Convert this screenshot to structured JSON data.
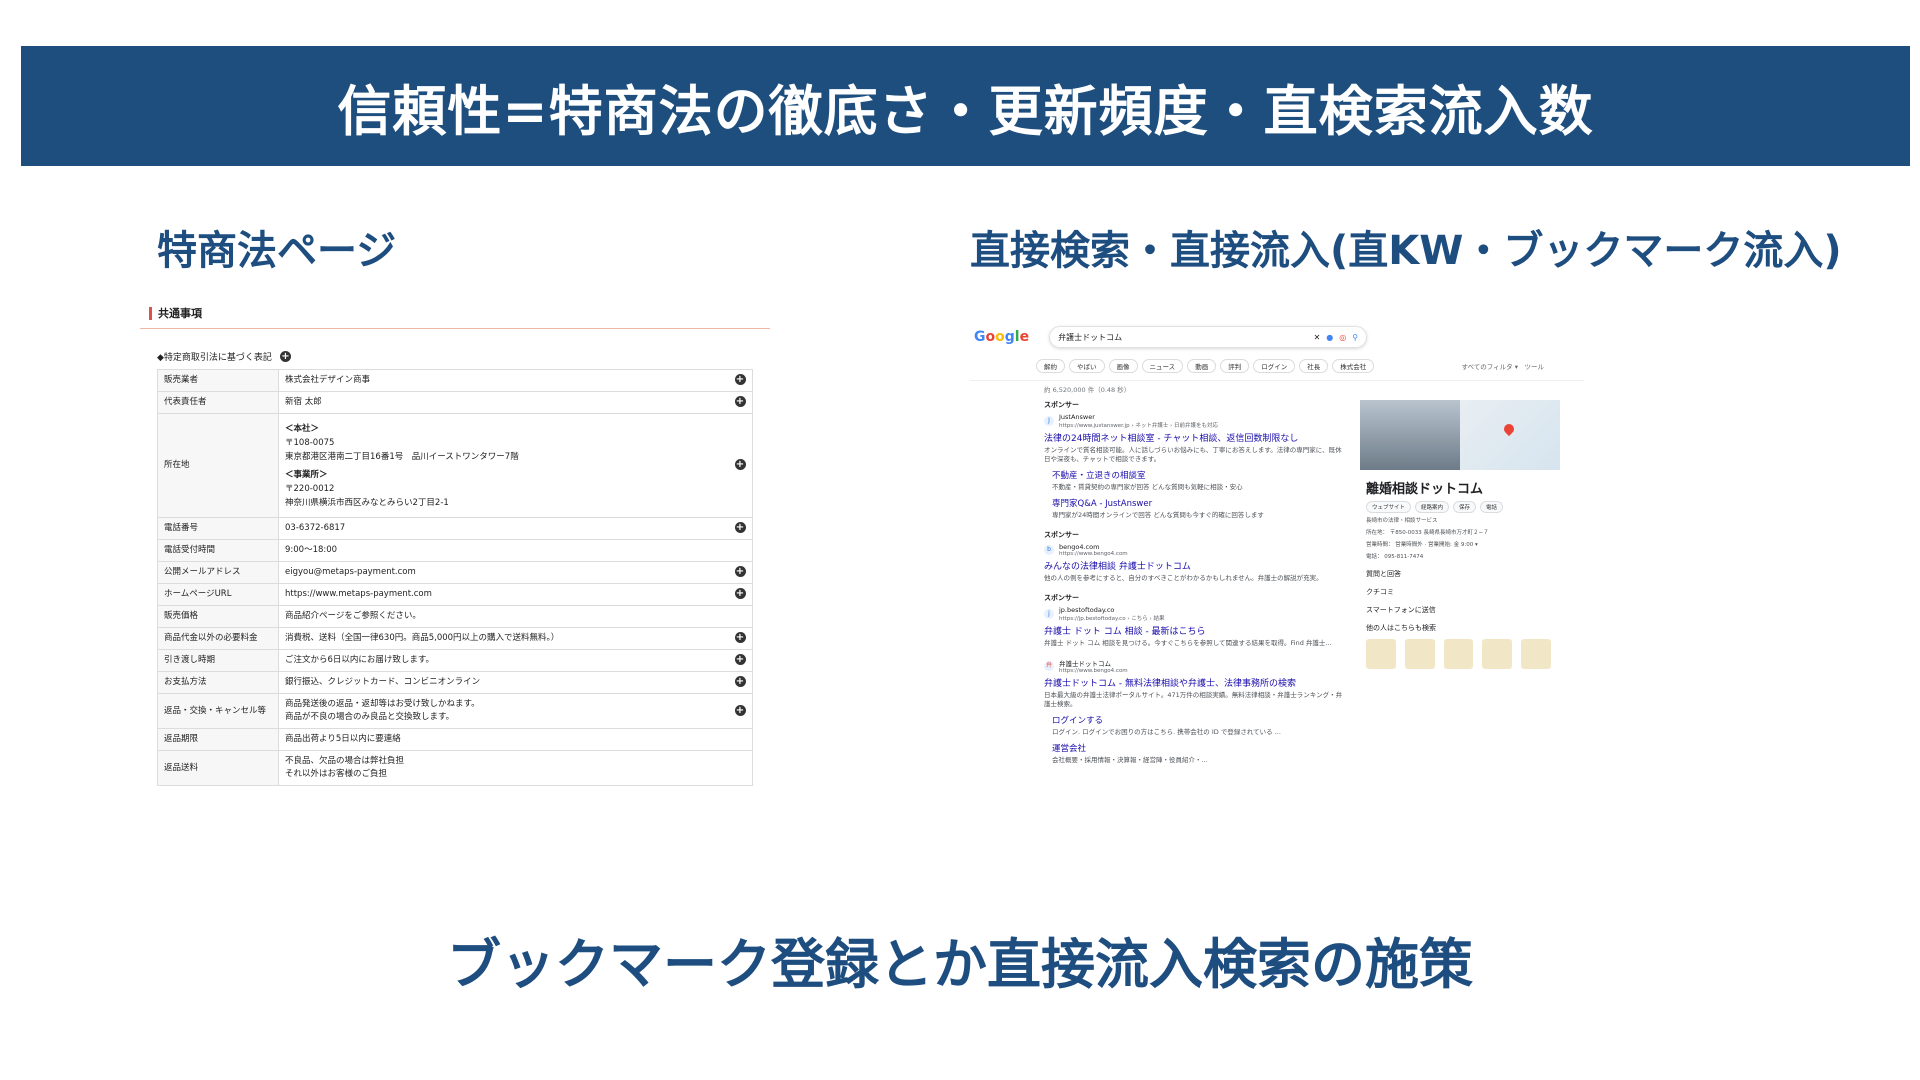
{
  "title": "信頼性=特商法の徹底さ・更新頻度・直検索流入数",
  "left_heading": "特商法ページ",
  "right_heading": "直接検索・直接流入(直KW・ブックマーク流入)",
  "footer": "ブックマーク登録とか直接流入検索の施策",
  "tokusho": {
    "section": "共通事項",
    "note": "◆特定商取引法に基づく表記",
    "rows": [
      {
        "k": "販売業者",
        "v": "株式会社デザイン商事"
      },
      {
        "k": "代表責任者",
        "v": "新宿 太郎"
      },
      {
        "k": "電話番号",
        "v": "03-6372-6817"
      },
      {
        "k": "電話受付時間",
        "v": "9:00～18:00"
      },
      {
        "k": "公開メールアドレス",
        "v": "eigyou@metaps-payment.com"
      },
      {
        "k": "ホームページURL",
        "v": "https://www.metaps-payment.com"
      },
      {
        "k": "販売価格",
        "v": "商品紹介ページをご参照ください。"
      },
      {
        "k": "商品代金以外の必要料金",
        "v": "消費税、送料（全国一律630円。商品5,000円以上の購入で送料無料。）"
      },
      {
        "k": "引き渡し時期",
        "v": "ご注文から6日以内にお届け致します。"
      },
      {
        "k": "お支払方法",
        "v": "銀行振込、クレジットカード、コンビニオンライン"
      },
      {
        "k": "返品・交換・キャンセル等",
        "v1": "商品発送後の返品・返却等はお受け致しかねます。",
        "v2": "商品が不良の場合のみ良品と交換致します。"
      },
      {
        "k": "返品期限",
        "v": "商品出荷より5日以内に要連絡"
      },
      {
        "k": "返品送料",
        "v1": "不良品、欠品の場合は弊社負担",
        "v2": "それ以外はお客様のご負担"
      }
    ],
    "address": {
      "k": "所在地",
      "h1": "＜本社＞",
      "zip1": "〒108-0075",
      "a1": "東京都港区港南二丁目16番1号　品川イーストワンタワー7階",
      "h2": "＜事業所＞",
      "zip2": "〒220-0012",
      "a2": "神奈川県横浜市西区みなとみらい2丁目2-1"
    }
  },
  "google": {
    "logo": "Google",
    "query": "弁護士ドットコム",
    "chips": [
      "解約",
      "やばい",
      "画像",
      "ニュース",
      "動画",
      "評判",
      "ログイン",
      "社長",
      "株式会社"
    ],
    "tools": "すべてのフィルタ ▾　ツール",
    "count": "約 6,520,000 件（0.48 秒）",
    "sponsor": "スポンサー",
    "r1_site": "JustAnswer",
    "r1_url": "https://www.justanswer.jp › ネット弁護士 › 日前弁護をも対応",
    "r1_title": "法律の24時間ネット相談室 - チャット相談、返信回数制限なし",
    "r1_snip": "オンラインで質名相談可能。人に話しづらいお悩みにも、丁寧にお答えします。法律の専門家に、既休日や深夜も、チャットで相談できます。",
    "r1_sub1": "不動産・立退きの相談室",
    "r1_sub1_snip": "不動産・賃貸契約の専門家が回答 どんな質問も気軽に相談・安心",
    "r1_sub2": "専門家Q&A - JustAnswer",
    "r1_sub2_snip": "専門家が24時間オンラインで回答 どんな質問も今すぐ的確に回答します",
    "r2_site": "bengo4.com",
    "r2_url": "https://www.bengo4.com",
    "r2_title": "みんなの法律相談 弁護士ドットコム",
    "r2_snip": "他の人の例を参考にすると、自分のすべきことがわかるかもしれません。弁護士の解説が充実。",
    "r3_site": "jp.bestoftoday.co",
    "r3_url": "https://jp.bestoftoday.co › こちら › 結果",
    "r3_title": "弁護士 ドット コム 相談 - 最新はこちら",
    "r3_snip": "弁護士 ドット コム 相談を見つける。今すぐこちらを参照して関連する結果を取得。Find 弁護士...",
    "r4_site": "弁護士ドットコム",
    "r4_url": "https://www.bengo4.com",
    "r4_title": "弁護士ドットコム - 無料法律相談や弁護士、法律事務所の検索",
    "r4_snip": "日本最大級の弁護士法律ポータルサイト。471万件の相談実績。無料法律相談・弁護士ランキング・弁護士検索。",
    "r4_sub1": "ログインする",
    "r4_sub1_snip": "ログイン. ログインでお困りの方はこちら. 携帯会社の ID で登録されている ...",
    "r4_sub2": "運営会社",
    "r4_sub2_snip": "会社概要・採用情報・決算報・経営陣・役員紹介・...",
    "kp_name": "離婚相談ドットコム",
    "kp_btns": [
      "ウェブサイト",
      "経路案内",
      "保存",
      "電話"
    ],
    "kp_type": "長崎市の法律・相談サービス",
    "kp_addr": "所在地： 〒850-0033 長崎県長崎市万才町２−７",
    "kp_hours": "営業時間： 営業時間外 · 営業開始: 金 9:00 ▾",
    "kp_tel": "電話： 095-811-7474",
    "kp_qa": "質問と回答",
    "kp_review": "クチコミ",
    "kp_phone": "スマートフォンに送信",
    "kp_others": "他の人はこちらも検索"
  }
}
